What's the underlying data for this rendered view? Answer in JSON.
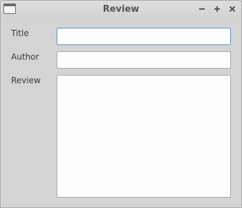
{
  "window": {
    "title": "Review",
    "controls": {
      "minimize": "minimize-icon",
      "maximize": "maximize-icon",
      "close": "close-icon"
    }
  },
  "form": {
    "title_label": "Title",
    "title_value": "",
    "author_label": "Author",
    "author_value": "",
    "review_label": "Review",
    "review_value": ""
  },
  "colors": {
    "focus_border": "#5b8fd0",
    "background": "#d4d4d4"
  }
}
